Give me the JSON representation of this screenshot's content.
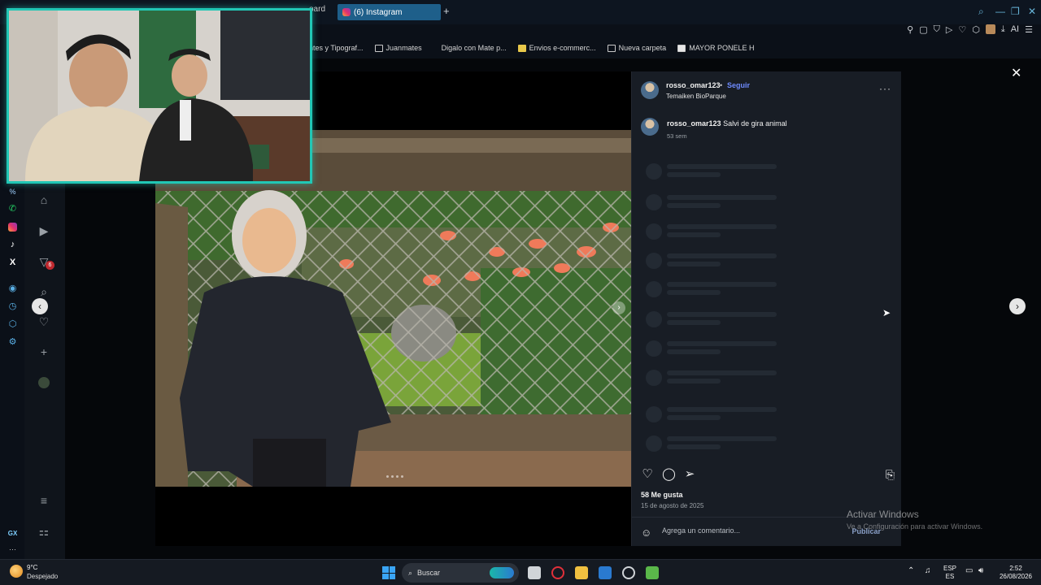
{
  "browser": {
    "tabs": [
      {
        "label": "oard",
        "active": false
      },
      {
        "label": "(6) Instagram",
        "active": true
      }
    ],
    "new_tab": "+",
    "window_controls": [
      "⌕",
      "—",
      "❐",
      "✕"
    ],
    "toolbar_ai": "AI",
    "bookmarks": [
      {
        "label": "ntes y Tipograf..."
      },
      {
        "label": "Juanmates"
      },
      {
        "label": "Digalo con Mate p..."
      },
      {
        "label": "Envios e-commerc..."
      },
      {
        "label": "Nueva carpeta"
      },
      {
        "label": "MAYOR PONELE H"
      }
    ]
  },
  "sidebar": {
    "gx_label": "GX",
    "percent_label": "%",
    "more_label": "···",
    "notification_count": "6"
  },
  "post": {
    "username": "rosso_omar123",
    "separator": "•",
    "follow_label": "Seguir",
    "location": "Temaiken BioParque",
    "caption_user": "rosso_omar123",
    "caption_text": "Salvi de gira animal",
    "caption_time": "53 sem",
    "likes": "58 Me gusta",
    "date": "15 de agosto de 2025",
    "comment_placeholder": "Agrega un comentario...",
    "publish_label": "Publicar"
  },
  "watermark": {
    "title": "Activar Windows",
    "subtitle": "Ve a Configuración para activar Windows."
  },
  "taskbar": {
    "temperature": "9°C",
    "condition": "Despejado",
    "search_label": "Buscar",
    "lang_top": "ESP",
    "lang_bottom": "ES",
    "time": "2:52",
    "date": "26/08/2026"
  },
  "colors": {
    "accent_follow": "#6e8bff",
    "tab_active": "#1e5f8a",
    "webcam_border": "#21c7b5"
  }
}
